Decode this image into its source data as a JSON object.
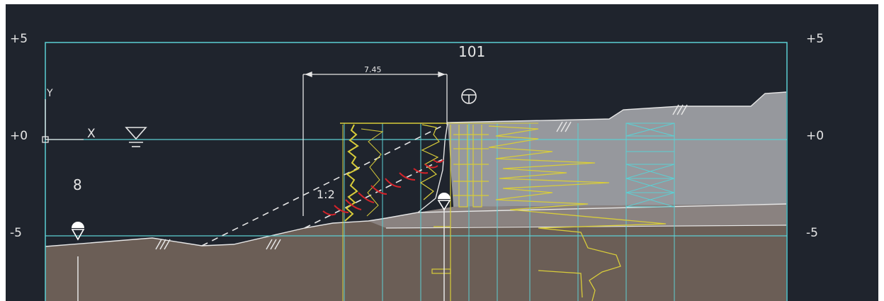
{
  "elevation_labels": {
    "left": [
      "+5",
      "+0",
      "-5"
    ],
    "right": [
      "+5",
      "+0",
      "-5"
    ]
  },
  "section_number": "101",
  "dimension": "7.45",
  "slope_ratio": "1:2",
  "zone_number": "8",
  "axis_y": "Y",
  "axis_x": "X",
  "symbols": [
    "water-level-symbol",
    "benchmark-symbol",
    "level-marker-symbol",
    "soil-hatch-symbol"
  ],
  "colors": {
    "background": "#1f242d",
    "frame": "#5ccfd3",
    "deep_soil": "#6b5e56",
    "mid_soil": "#8a8280",
    "upper_soil": "#96989d",
    "borehole_log": "#d8cc3a",
    "slip_marks": "#d4232a",
    "drawing_lines": "#e0e0e0"
  }
}
